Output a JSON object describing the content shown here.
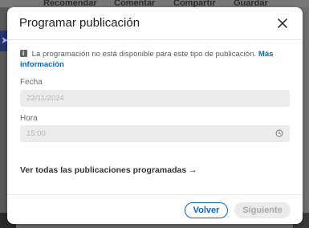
{
  "background": {
    "actions": [
      "Recomendar",
      "Comentar",
      "Compartir",
      "Guardar"
    ]
  },
  "modal": {
    "title": "Programar publicación",
    "notice": {
      "text": "La programación no está disponible para este tipo de publicación.",
      "link": "Más información"
    },
    "date": {
      "label": "Fecha",
      "value": "22/11/2024"
    },
    "time": {
      "label": "Hora",
      "value": "15:00"
    },
    "view_all_link": "Ver todas las publicaciones programadas →",
    "footer": {
      "back_label": "Volver",
      "next_label": "Siguiente"
    }
  },
  "colors": {
    "accent": "#0a66c2",
    "disabled_bg": "#ebebeb"
  }
}
